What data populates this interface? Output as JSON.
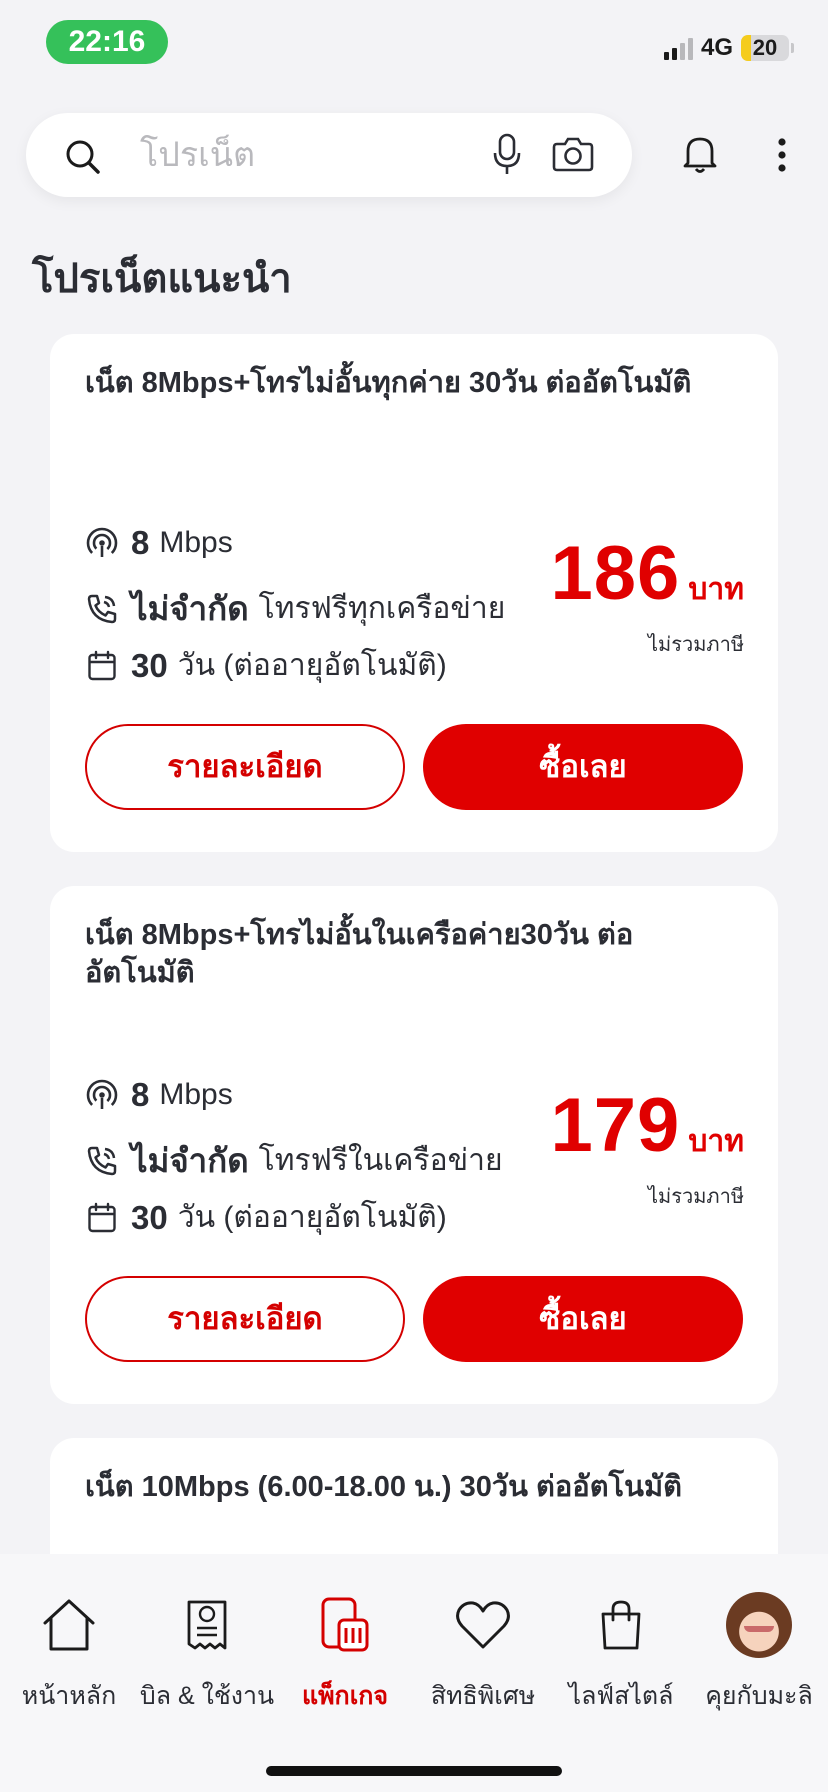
{
  "status_bar": {
    "time": "22:16",
    "network": "4G",
    "battery": "20",
    "battery_fraction": 0.2
  },
  "search": {
    "placeholder": "โปรเน็ต"
  },
  "section": {
    "title": "โปรเน็ตแนะนำ"
  },
  "cards": [
    {
      "title": "เน็ต 8Mbps+โทรไม่อั้นทุกค่าย 30วัน ต่ออัตโนมัติ",
      "speed_value": "8",
      "speed_unit": "Mbps",
      "call_strong": "ไม่จำกัด",
      "call_text": "โทรฟรีทุกเครือข่าย",
      "days_value": "30",
      "days_text": "วัน (ต่ออายุอัตโนมัติ)",
      "price": "186",
      "price_unit": "บาท",
      "vat_note": "ไม่รวมภาษี",
      "detail_label": "รายละเอียด",
      "buy_label": "ซื้อเลย"
    },
    {
      "title": "เน็ต 8Mbps+โทรไม่อั้นในเครือค่าย30วัน ต่ออัตโนมัติ",
      "speed_value": "8",
      "speed_unit": "Mbps",
      "call_strong": "ไม่จำกัด",
      "call_text": "โทรฟรีในเครือข่าย",
      "days_value": "30",
      "days_text": "วัน (ต่ออายุอัตโนมัติ)",
      "price": "179",
      "price_unit": "บาท",
      "vat_note": "ไม่รวมภาษี",
      "detail_label": "รายละเอียด",
      "buy_label": "ซื้อเลย"
    },
    {
      "title": "เน็ต 10Mbps (6.00-18.00 น.) 30วัน ต่ออัตโนมัติ"
    }
  ],
  "bottom_nav": [
    {
      "label": "หน้าหลัก",
      "icon": "home-icon"
    },
    {
      "label": "บิล & ใช้งาน",
      "icon": "bill-icon"
    },
    {
      "label": "แพ็กเกจ",
      "icon": "package-icon",
      "active": true
    },
    {
      "label": "สิทธิพิเศษ",
      "icon": "heart-icon"
    },
    {
      "label": "ไลฟ์สไตล์",
      "icon": "shopping-bag-icon"
    },
    {
      "label": "คุยกับมะลิ",
      "icon": "assistant-avatar"
    }
  ],
  "colors": {
    "accent_red": "#e00000",
    "status_green": "#35c15a",
    "background": "#f3f3f6"
  }
}
